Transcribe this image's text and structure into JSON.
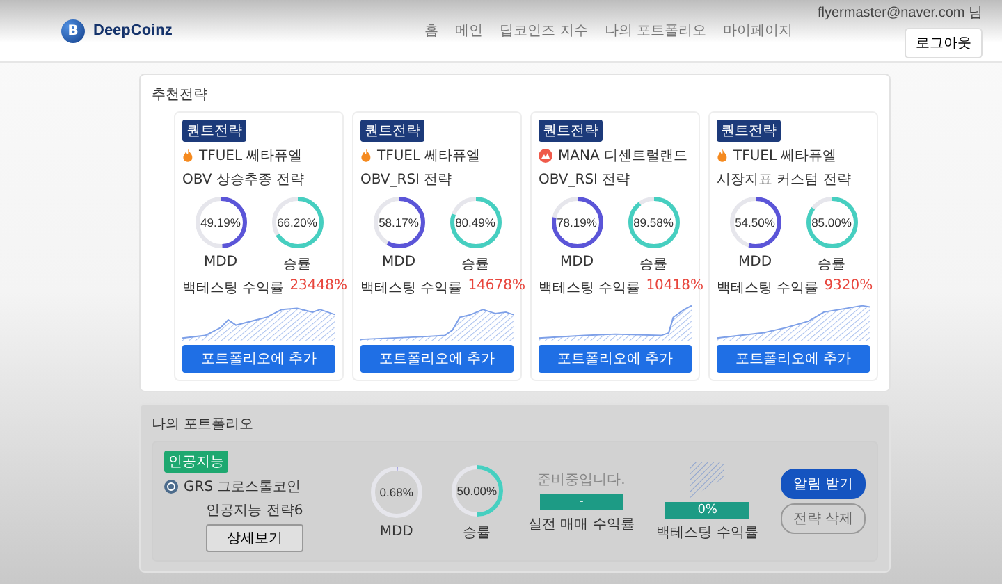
{
  "header": {
    "logo": {
      "mark": "B",
      "name": "DeepCoinz"
    },
    "nav": [
      {
        "label": "홈",
        "selected": false
      },
      {
        "label": "메인",
        "selected": false
      },
      {
        "label": "딥코인즈 지수",
        "selected": false
      },
      {
        "label": "나의 포트폴리오",
        "selected": false
      },
      {
        "label": "마이페이지",
        "selected": false
      }
    ],
    "user": "flyermaster@naver.com 님",
    "logout": "로그아웃"
  },
  "recommended": {
    "title": "추천전략",
    "cards": [
      {
        "badge": "퀀트전략",
        "coin": {
          "kind": "flame",
          "name": "TFUEL 쎄타퓨엘"
        },
        "title": "OBV 상승추종 전략",
        "stats": [
          {
            "kind": "mdd",
            "value": "49.19%",
            "level": 0.4919,
            "label": "MDD"
          },
          {
            "kind": "win",
            "value": "66.20%",
            "level": 0.662,
            "label": "승률"
          }
        ],
        "return": {
          "label": "백테스팅 수익률",
          "value": "23448%"
        },
        "button": "포트폴리오에 추가"
      },
      {
        "badge": "퀀트전략",
        "coin": {
          "kind": "flame",
          "name": "TFUEL 쎄타퓨엘"
        },
        "title": "OBV_RSI 전략",
        "stats": [
          {
            "kind": "mdd",
            "value": "58.17%",
            "level": 0.5817,
            "label": "MDD"
          },
          {
            "kind": "win",
            "value": "80.49%",
            "level": 0.8049,
            "label": "승률"
          }
        ],
        "return": {
          "label": "백테스팅 수익률",
          "value": "14678%"
        },
        "button": "포트폴리오에 추가"
      },
      {
        "badge": "퀀트전략",
        "coin": {
          "kind": "mana",
          "name": "MANA 디센트럴랜드"
        },
        "title": "OBV_RSI 전략",
        "stats": [
          {
            "kind": "mdd",
            "value": "78.19%",
            "level": 0.7819,
            "label": "MDD"
          },
          {
            "kind": "win",
            "value": "89.58%",
            "level": 0.8958,
            "label": "승률"
          }
        ],
        "return": {
          "label": "백테스팅 수익률",
          "value": "10418%"
        },
        "button": "포트폴리오에 추가"
      },
      {
        "badge": "퀀트전략",
        "coin": {
          "kind": "flame",
          "name": "TFUEL 쎄타퓨엘"
        },
        "title": "시장지표 커스텀 전략",
        "stats": [
          {
            "kind": "mdd",
            "value": "54.50%",
            "level": 0.545,
            "label": "MDD"
          },
          {
            "kind": "win",
            "value": "85.00%",
            "level": 0.85,
            "label": "승률"
          }
        ],
        "return": {
          "label": "백테스팅 수익률",
          "value": "9320%"
        },
        "button": "포트폴리오에 추가"
      }
    ]
  },
  "portfolio": {
    "title": "나의 포트폴리오",
    "items": [
      {
        "badge": "인공지능",
        "coin": {
          "kind": "grs",
          "name": "GRS 그로스톨코인"
        },
        "strategy": "인공지능 전략6",
        "detail": "상세보기",
        "stats": [
          {
            "kind": "mdd",
            "value": "0.68%",
            "level": 0.0068,
            "label": "MDD"
          },
          {
            "kind": "win",
            "value": "50.00%",
            "level": 0.5,
            "label": "승률"
          }
        ],
        "live": {
          "note": "준비중입니다.",
          "value": "-",
          "label": "실전 매매 수익률"
        },
        "backtest": {
          "value": "0%",
          "label": "백테스팅 수익률"
        },
        "alert": "알림 받기",
        "delete": "전략 삭제"
      }
    ]
  }
}
